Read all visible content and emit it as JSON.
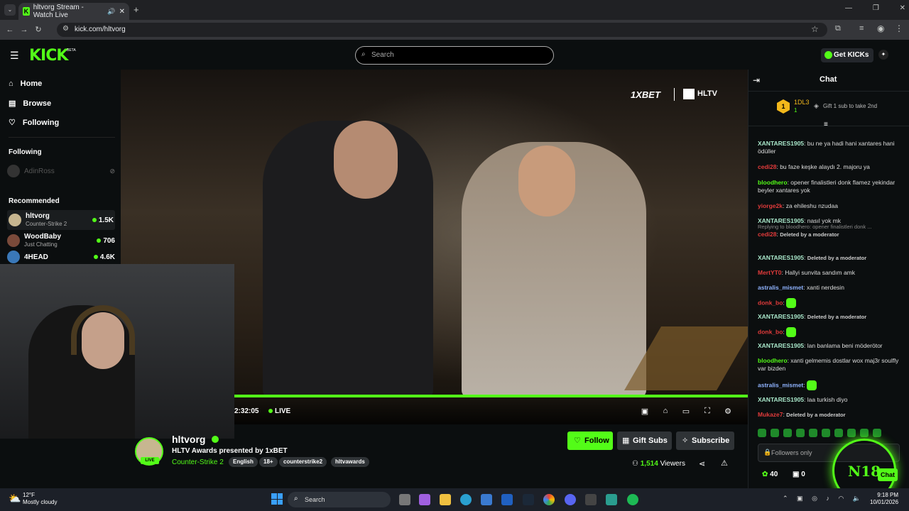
{
  "browser": {
    "tab_title": "hltvorg Stream - Watch Live",
    "url": "kick.com/hltvorg"
  },
  "header": {
    "logo": "KICK",
    "beta": "BETA",
    "search_placeholder": "Search",
    "get_kicks": "Get KICKs"
  },
  "sidebar": {
    "nav": [
      {
        "label": "Home",
        "icon": "home-icon"
      },
      {
        "label": "Browse",
        "icon": "browse-icon"
      },
      {
        "label": "Following",
        "icon": "heart-icon"
      }
    ],
    "following_title": "Following",
    "following": [
      {
        "name": "AdinRoss"
      }
    ],
    "recommended_title": "Recommended",
    "recommended": [
      {
        "name": "hltvorg",
        "category": "Counter-Strike 2",
        "viewers": "1.5K"
      },
      {
        "name": "WoodBaby",
        "category": "Just Chatting",
        "viewers": "706"
      },
      {
        "name": "4HEAD",
        "category": "",
        "viewers": "4.6K"
      }
    ]
  },
  "video": {
    "sponsor": "1XBET",
    "brand": "HLTV",
    "time": "2:32:05",
    "live": "LIVE",
    "progress": 1.0
  },
  "stream": {
    "channel": "hltvorg",
    "title": "HLTV Awards presented by 1xBET",
    "category": "Counter-Strike 2",
    "live_badge": "LIVE",
    "tags": [
      "English",
      "18+",
      "counterstrike2",
      "hltvawards"
    ],
    "follow": "Follow",
    "gift_subs": "Gift Subs",
    "subscribe": "Subscribe",
    "viewers": "1,514",
    "viewers_label": "Viewers"
  },
  "chat": {
    "title": "Chat",
    "pinned": {
      "rank": "1",
      "user": "1DL3",
      "count": "1",
      "gift_text": "Gift 1 sub to take 2nd"
    },
    "messages": [
      {
        "user": "XANTARES1905",
        "color": "#a8e6c9",
        "text": "bu ne ya hadi hani xantares hani ödüller"
      },
      {
        "user": "cedi28",
        "color": "#e23b3b",
        "text": "bu faze keşke alaydı 2. majoru ya"
      },
      {
        "user": "bloodhero",
        "color": "#53fc18",
        "text": "opener finalistleri donk flamez yekindar beyler xantares yok"
      },
      {
        "user": "yiorge2k",
        "color": "#e23b3b",
        "text": "za ehileshu nzudaa"
      },
      {
        "user": "XANTARES1905",
        "color": "#a8e6c9",
        "text": "nasıl yok mk"
      },
      {
        "user": "cedi28",
        "color": "#e23b3b",
        "text": "Deleted by a moderator",
        "reply": "Replying to bloodhero: opener finalistleri donk ...",
        "deleted": true
      },
      {
        "user": "XANTARES1905",
        "color": "#a8e6c9",
        "text": "Deleted by a moderator",
        "deleted": true
      },
      {
        "user": "MertYT0",
        "color": "#e23b3b",
        "text": "Hallyi sunvita sandım amk"
      },
      {
        "user": "astralis_mismet",
        "color": "#8fb3ff",
        "text": "xanti nerdesin"
      },
      {
        "user": "donk_bo",
        "color": "#e23b3b",
        "text": "",
        "emote": true
      },
      {
        "user": "XANTARES1905",
        "color": "#a8e6c9",
        "text": "Deleted by a moderator",
        "deleted": true
      },
      {
        "user": "donk_bo",
        "color": "#e23b3b",
        "text": "",
        "emote": true
      },
      {
        "user": "XANTARES1905",
        "color": "#a8e6c9",
        "text": "lan banlama beni möderötor"
      },
      {
        "user": "bloodhero",
        "color": "#53fc18",
        "text": "xanti gelmemis dostlar wox maj3r soulfly var bizden"
      },
      {
        "user": "astralis_mismet",
        "color": "#8fb3ff",
        "text": "",
        "emote": true
      },
      {
        "user": "XANTARES1905",
        "color": "#a8e6c9",
        "text": "laa turkish diyo"
      },
      {
        "user": "Mukaze7",
        "color": "#e23b3b",
        "text": "Deleted by a moderator",
        "deleted": true
      }
    ],
    "input_placeholder": "Followers only",
    "points": "40",
    "points2": "0",
    "chat_button": "Chat",
    "overlay": "N18"
  },
  "taskbar": {
    "temp": "12°F",
    "weather": "Mostly cloudy",
    "search": "Search",
    "time": "9:18 PM",
    "date": "10/01/2026"
  }
}
